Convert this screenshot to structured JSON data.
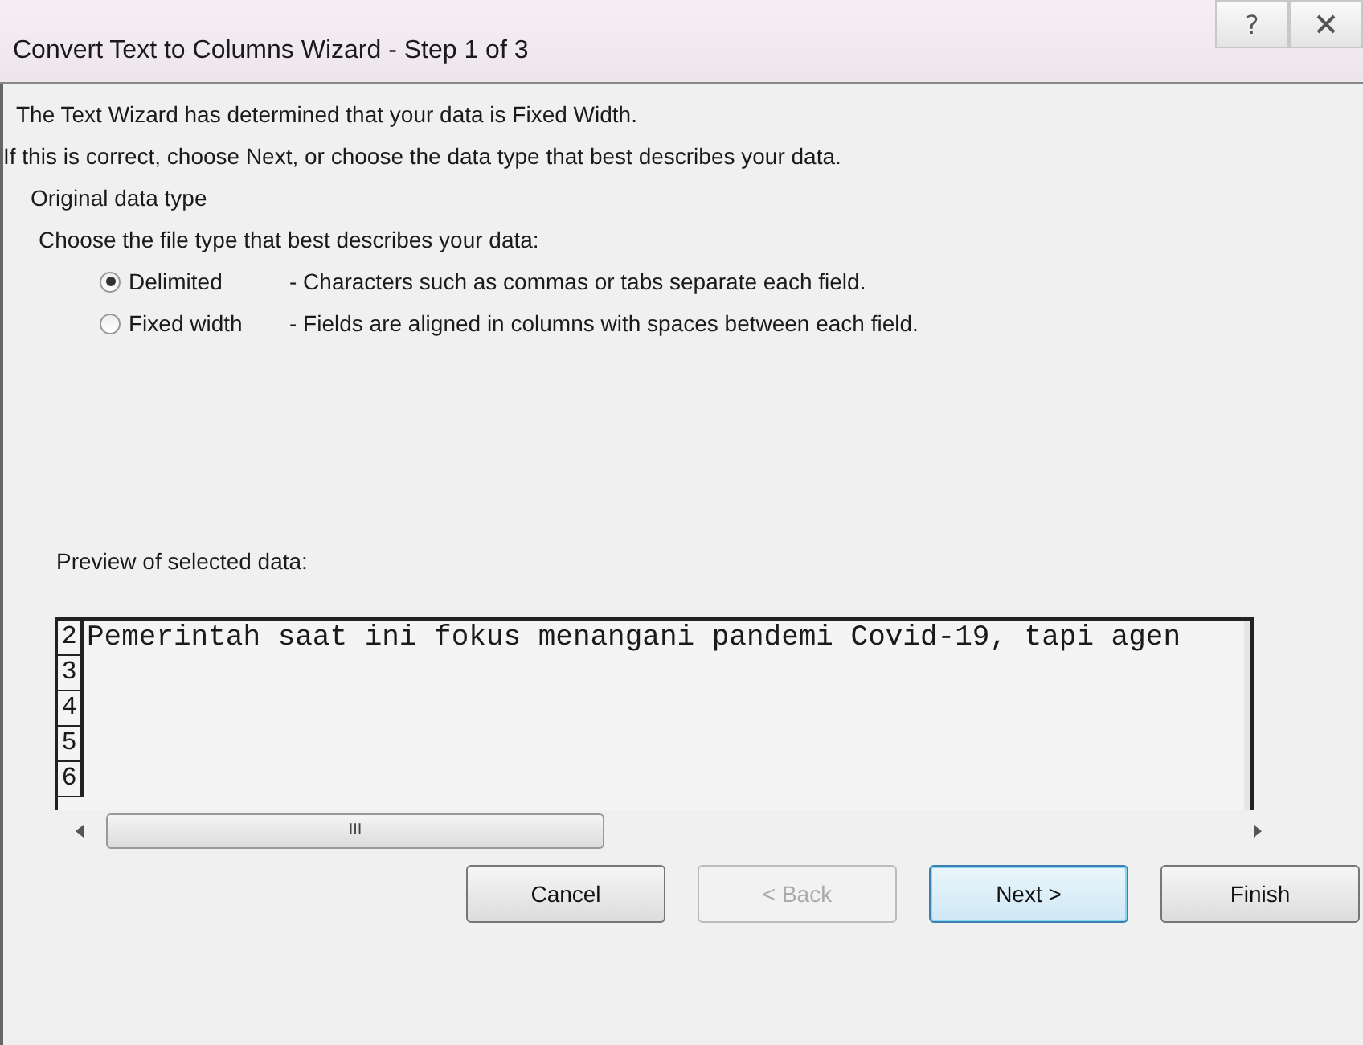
{
  "window": {
    "title": "Convert Text to Columns Wizard - Step 1 of 3",
    "help_button": "?"
  },
  "intro": [
    "The Text Wizard has determined that your data is Fixed Width.",
    "If this is correct, choose Next, or choose the data type that best describes your data."
  ],
  "group": {
    "title": "Original data type",
    "prompt": "Choose the file type that best describes your data:",
    "options": [
      {
        "label": "Delimited",
        "description": "- Characters such as commas or tabs separate each field.",
        "selected": true
      },
      {
        "label": "Fixed width",
        "description": "- Fields are aligned in columns with spaces between each field.",
        "selected": false
      }
    ]
  },
  "preview": {
    "label": "Preview of selected data:",
    "rows": [
      {
        "number": "2",
        "text": "Pemerintah saat ini fokus menangani pandemi Covid-19, tapi agen"
      },
      {
        "number": "3",
        "text": ""
      },
      {
        "number": "4",
        "text": ""
      },
      {
        "number": "5",
        "text": ""
      },
      {
        "number": "6",
        "text": ""
      }
    ],
    "scrollbar_grip": "III"
  },
  "buttons": [
    {
      "label": "Cancel",
      "disabled": false,
      "default": false
    },
    {
      "label": "< Back",
      "disabled": true,
      "default": false
    },
    {
      "label": "Next >",
      "disabled": false,
      "default": true
    },
    {
      "label": "Finish",
      "disabled": false,
      "default": false
    }
  ]
}
